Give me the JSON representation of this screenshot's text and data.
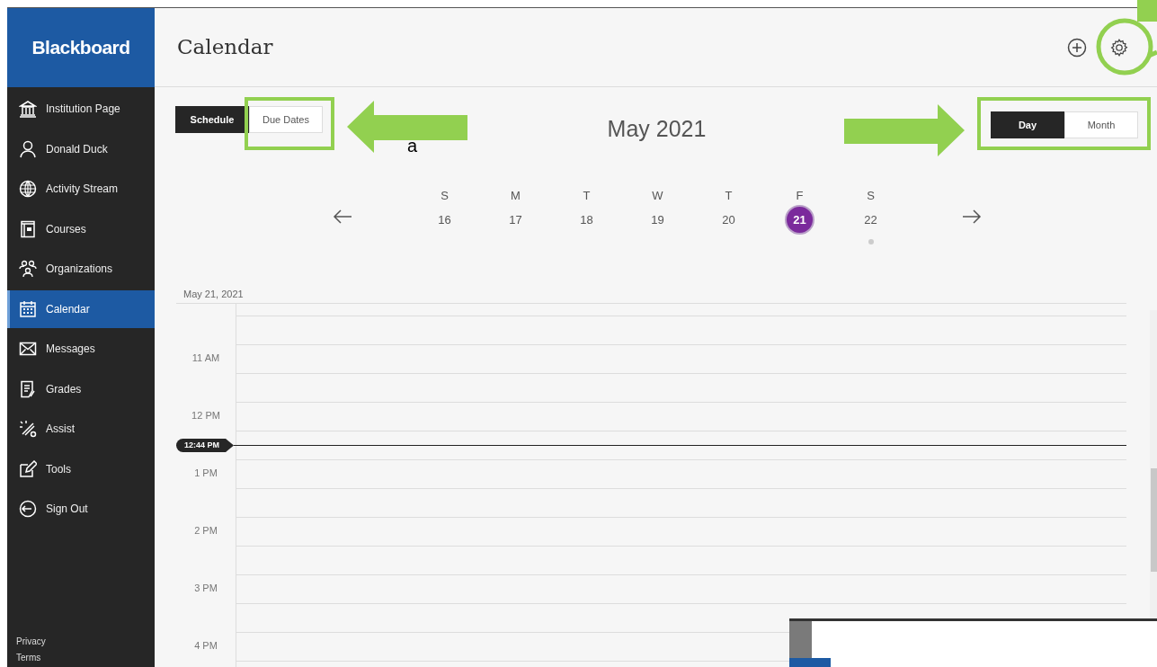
{
  "sidebar": {
    "logo": "Blackboard",
    "items": [
      {
        "label": "Institution Page",
        "selected": false
      },
      {
        "label": "Donald Duck",
        "selected": false
      },
      {
        "label": "Activity Stream",
        "selected": false
      },
      {
        "label": "Courses",
        "selected": false
      },
      {
        "label": "Organizations",
        "selected": false
      },
      {
        "label": "Calendar",
        "selected": true
      },
      {
        "label": "Messages",
        "selected": false
      },
      {
        "label": "Grades",
        "selected": false
      },
      {
        "label": "Assist",
        "selected": false
      },
      {
        "label": "Tools",
        "selected": false
      },
      {
        "label": "Sign Out",
        "selected": false
      }
    ],
    "footer_links": [
      "Privacy",
      "Terms"
    ]
  },
  "header": {
    "title": "Calendar"
  },
  "view_tabs": [
    {
      "label": "Schedule",
      "selected": true
    },
    {
      "label": "Due Dates",
      "selected": false
    }
  ],
  "month": "May 2021",
  "range_tabs": [
    {
      "label": "Day",
      "selected": true
    },
    {
      "label": "Month",
      "selected": false
    }
  ],
  "week": [
    {
      "weekday": "S",
      "date": "16",
      "selected": false,
      "has_events": false
    },
    {
      "weekday": "M",
      "date": "17",
      "selected": false,
      "has_events": false
    },
    {
      "weekday": "T",
      "date": "18",
      "selected": false,
      "has_events": false
    },
    {
      "weekday": "W",
      "date": "19",
      "selected": false,
      "has_events": false
    },
    {
      "weekday": "T",
      "date": "20",
      "selected": false,
      "has_events": false
    },
    {
      "weekday": "F",
      "date": "21",
      "selected": true,
      "has_events": false
    },
    {
      "weekday": "S",
      "date": "22",
      "selected": false,
      "has_events": true
    }
  ],
  "date_heading": "May 21, 2021",
  "hours": [
    "11 AM",
    "12 PM",
    "1 PM",
    "2 PM",
    "3 PM",
    "4 PM"
  ],
  "now_marker": "12:44 PM",
  "annotation_label": "a"
}
